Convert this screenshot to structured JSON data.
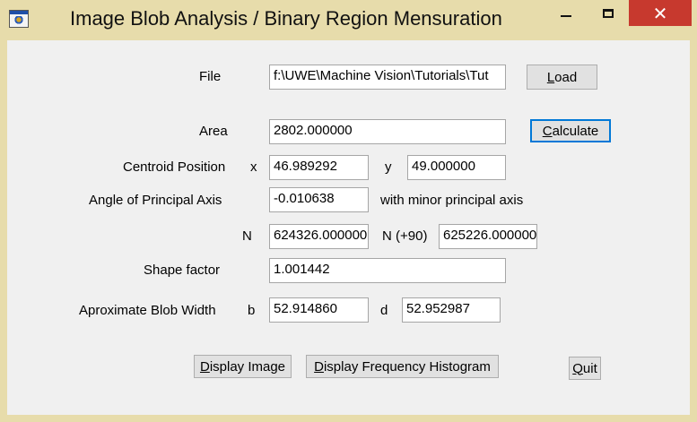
{
  "window": {
    "title": "Image Blob Analysis / Binary Region Mensuration",
    "close_glyph": "✕"
  },
  "file": {
    "label": "File",
    "value": "f:\\UWE\\Machine Vision\\Tutorials\\Tut",
    "load_button": {
      "hotkey": "L",
      "rest": "oad"
    }
  },
  "area": {
    "label": "Area",
    "value": "2802.000000",
    "calculate_button": {
      "hotkey": "C",
      "rest": "alculate"
    }
  },
  "centroid": {
    "label": "Centroid Position",
    "x_label": "x",
    "x_value": "46.989292",
    "y_label": "y",
    "y_value": "49.000000"
  },
  "principal_axis": {
    "label": "Angle of Principal Axis",
    "value": "-0.010638",
    "note": "with minor principal axis"
  },
  "n_values": {
    "n_label": "N",
    "n_value": "624326.000000",
    "n90_label": "N (+90)",
    "n90_value": "625226.000000"
  },
  "shape_factor": {
    "label": "Shape factor",
    "value": "1.001442"
  },
  "blob_width": {
    "label": "Aproximate Blob Width",
    "b_label": "b",
    "b_value": "52.914860",
    "d_label": "d",
    "d_value": "52.952987"
  },
  "actions": {
    "display_image": {
      "hotkey": "D",
      "rest": "isplay Image"
    },
    "display_histogram": {
      "hotkey": "D",
      "rest": "isplay Frequency Histogram"
    },
    "quit": {
      "hotkey": "Q",
      "rest": "uit"
    }
  },
  "colors": {
    "frame": "#e7dcab",
    "client": "#f0f0f0",
    "close_button": "#c7392e",
    "focus": "#0078d7"
  },
  "icons": [
    "app-icon",
    "minimize-icon",
    "maximize-icon",
    "close-icon"
  ]
}
